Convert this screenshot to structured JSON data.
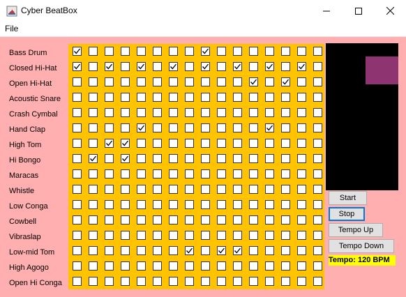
{
  "window": {
    "title": "Cyber BeatBox"
  },
  "menu": {
    "file": "File"
  },
  "colors": {
    "background": "#ffafaf",
    "grid": "#ffc300",
    "monitor": "#000000",
    "monitor_rect": "#8e3470",
    "tempo_bg": "#ffff00"
  },
  "instruments": [
    "Bass Drum",
    "Closed Hi-Hat",
    "Open Hi-Hat",
    "Acoustic Snare",
    "Crash Cymbal",
    "Hand Clap",
    "High Tom",
    "Hi Bongo",
    "Maracas",
    "Whistle",
    "Low Conga",
    "Cowbell",
    "Vibraslap",
    "Low-mid Tom",
    "High Agogo",
    "Open Hi Conga"
  ],
  "pattern": [
    [
      1,
      0,
      0,
      0,
      0,
      0,
      0,
      0,
      1,
      0,
      0,
      0,
      0,
      0,
      0,
      0
    ],
    [
      1,
      0,
      1,
      0,
      1,
      0,
      1,
      0,
      1,
      0,
      1,
      0,
      1,
      0,
      1,
      0
    ],
    [
      0,
      0,
      0,
      0,
      0,
      0,
      0,
      0,
      0,
      0,
      0,
      1,
      0,
      1,
      0,
      0
    ],
    [
      0,
      0,
      0,
      0,
      0,
      0,
      0,
      0,
      0,
      0,
      0,
      0,
      0,
      0,
      0,
      0
    ],
    [
      0,
      0,
      0,
      0,
      0,
      0,
      0,
      0,
      0,
      0,
      0,
      0,
      0,
      0,
      0,
      0
    ],
    [
      0,
      0,
      0,
      0,
      1,
      0,
      0,
      0,
      0,
      0,
      0,
      0,
      1,
      0,
      0,
      0
    ],
    [
      0,
      0,
      1,
      1,
      0,
      0,
      0,
      0,
      0,
      0,
      0,
      0,
      0,
      0,
      0,
      0
    ],
    [
      0,
      1,
      0,
      1,
      0,
      0,
      0,
      0,
      0,
      0,
      0,
      0,
      0,
      0,
      0,
      0
    ],
    [
      0,
      0,
      0,
      0,
      0,
      0,
      0,
      0,
      0,
      0,
      0,
      0,
      0,
      0,
      0,
      0
    ],
    [
      0,
      0,
      0,
      0,
      0,
      0,
      0,
      0,
      0,
      0,
      0,
      0,
      0,
      0,
      0,
      0
    ],
    [
      0,
      0,
      0,
      0,
      0,
      0,
      0,
      0,
      0,
      0,
      0,
      0,
      0,
      0,
      0,
      0
    ],
    [
      0,
      0,
      0,
      0,
      0,
      0,
      0,
      0,
      0,
      0,
      0,
      0,
      0,
      0,
      0,
      0
    ],
    [
      0,
      0,
      0,
      0,
      0,
      0,
      0,
      0,
      0,
      0,
      0,
      0,
      0,
      0,
      0,
      0
    ],
    [
      0,
      0,
      0,
      0,
      0,
      0,
      0,
      1,
      0,
      1,
      1,
      0,
      0,
      0,
      0,
      0
    ],
    [
      0,
      0,
      0,
      0,
      0,
      0,
      0,
      0,
      0,
      0,
      0,
      0,
      0,
      0,
      0,
      0
    ],
    [
      0,
      0,
      0,
      0,
      0,
      0,
      0,
      0,
      0,
      0,
      0,
      0,
      0,
      0,
      0,
      0
    ]
  ],
  "buttons": {
    "start": "Start",
    "stop": "Stop",
    "tempo_up": "Tempo Up",
    "tempo_down": "Tempo Down"
  },
  "tempo_label": "Tempo: 120 BPM"
}
